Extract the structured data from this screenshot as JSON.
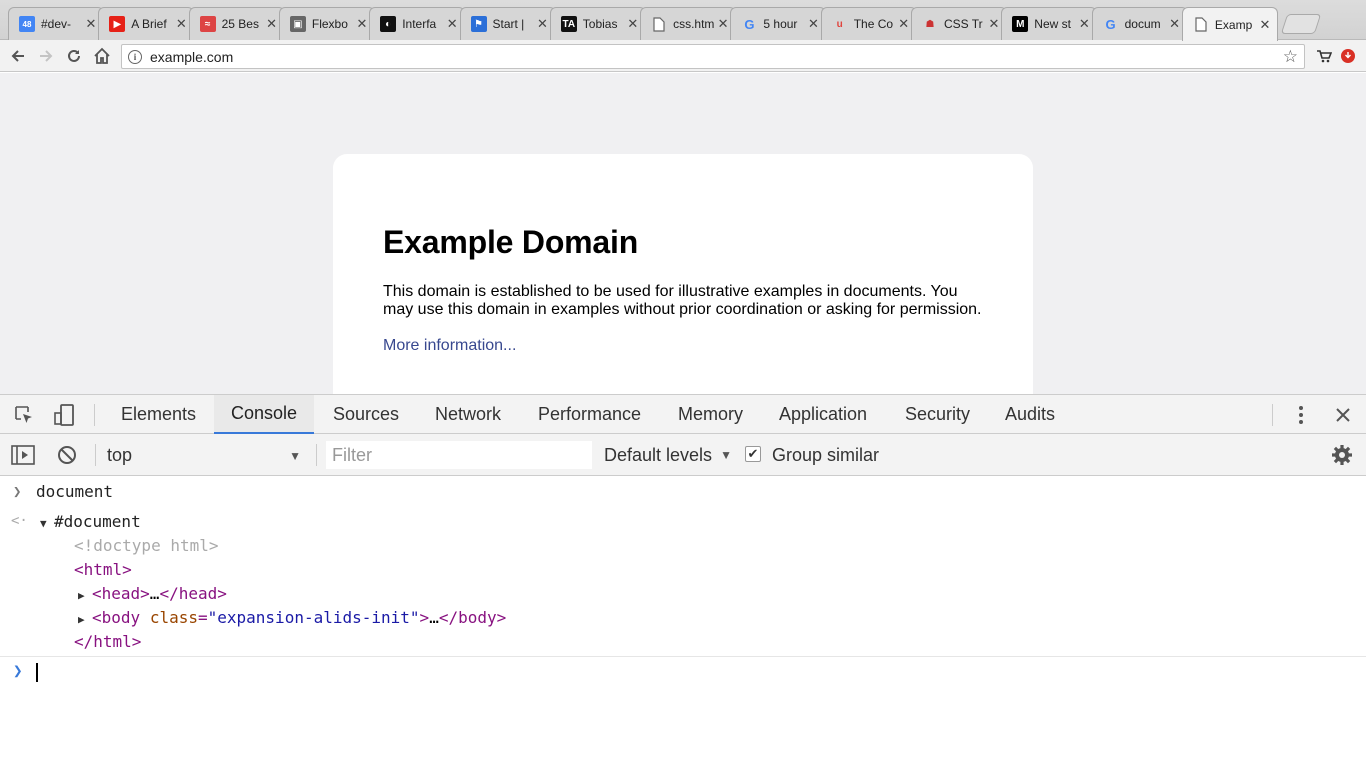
{
  "browser": {
    "tabs": [
      {
        "title": "#dev-",
        "icon": "calendar-icon",
        "color": "#4285f4"
      },
      {
        "title": "A Brief",
        "icon": "youtube-icon",
        "color": "#e62117"
      },
      {
        "title": "25 Bes",
        "icon": "brand-icon",
        "color": "#d44"
      },
      {
        "title": "Flexbo",
        "icon": "image-icon",
        "color": "#666"
      },
      {
        "title": "Interfa",
        "icon": "circle-icon",
        "color": "#111"
      },
      {
        "title": "Start |",
        "icon": "flag-icon",
        "color": "#2b6fd8"
      },
      {
        "title": "Tobias",
        "icon": "ta-logo-icon",
        "color": "#111"
      },
      {
        "title": "css.htm",
        "icon": "file-icon",
        "color": "#777"
      },
      {
        "title": "5 hour",
        "icon": "google-icon",
        "color": "#4285f4"
      },
      {
        "title": "The Co",
        "icon": "u-logo-icon",
        "color": "#e0443e"
      },
      {
        "title": "CSS Tr",
        "icon": "bot-icon",
        "color": "#c33"
      },
      {
        "title": "New st",
        "icon": "medium-icon",
        "color": "#000"
      },
      {
        "title": "docum",
        "icon": "google-icon",
        "color": "#4285f4"
      },
      {
        "title": "Examp",
        "icon": "file-icon",
        "color": "#777",
        "active": true
      }
    ],
    "calendar_badge": "48",
    "url": "example.com"
  },
  "page": {
    "heading": "Example Domain",
    "paragraph": "This domain is established to be used for illustrative examples in documents. You may use this domain in examples without prior coordination or asking for permission.",
    "link": "More information..."
  },
  "devtools": {
    "tabs": [
      "Elements",
      "Console",
      "Sources",
      "Network",
      "Performance",
      "Memory",
      "Application",
      "Security",
      "Audits"
    ],
    "active_tab": "Console",
    "context": "top",
    "filter_placeholder": "Filter",
    "levels": "Default levels",
    "group_similar": "Group similar",
    "group_similar_checked": true
  },
  "console": {
    "input": "document",
    "result_root": "#document",
    "doctype": "<!doctype html>",
    "html_open": "<html>",
    "head_open": "<head>",
    "ellipsis": "…",
    "head_close": "</head>",
    "body_tag": "<body",
    "body_attr": "class",
    "body_attr_value": "\"expansion-alids-init\"",
    "body_close": "</body>",
    "html_close": "</html>"
  },
  "colors": {
    "accent": "#3879d9",
    "link": "#38488f",
    "tag": "#881280",
    "attribute_name": "#994500",
    "attribute_value": "#1a1aa6"
  }
}
